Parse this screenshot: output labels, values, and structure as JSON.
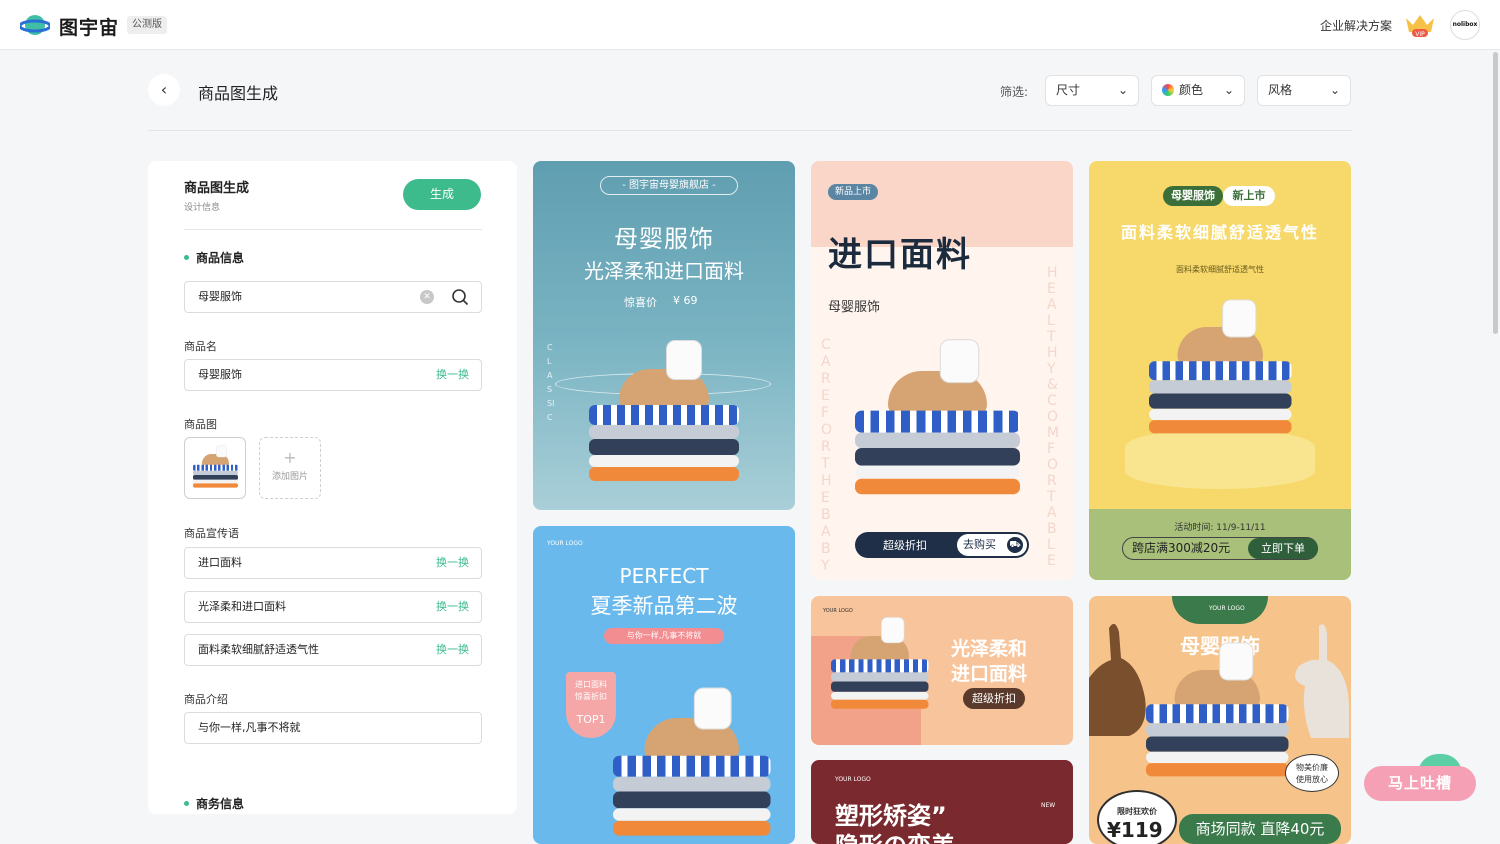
{
  "topbar": {
    "logo_text": "图宇宙",
    "beta_tag": "公测版",
    "enterprise": "企业解决方案",
    "vip_label": "VIP",
    "avatar_text": "nolibox"
  },
  "header": {
    "back_icon": "chevron-left-icon",
    "title": "商品图生成",
    "filter_label": "筛选:",
    "filters": [
      {
        "label": "尺寸"
      },
      {
        "label": "颜色"
      },
      {
        "label": "风格"
      }
    ]
  },
  "panel": {
    "title": "商品图生成",
    "subtitle": "设计信息",
    "generate_label": "生成",
    "section_product": "商品信息",
    "search_value": "母婴服饰",
    "name_label": "商品名",
    "name_value": "母婴服饰",
    "swap_label": "换一换",
    "image_label": "商品图",
    "add_image_label": "添加图片",
    "slogan_label": "商品宣传语",
    "slogans": [
      "进口面料",
      "光泽柔和进口面料",
      "面料柔软细腻舒适透气性"
    ],
    "intro_label": "商品介绍",
    "intro_value": "与你一样,凡事不将就",
    "section_business": "商务信息"
  },
  "cards": {
    "c1": {
      "store": "- 图宇宙母婴旗舰店 -",
      "line1": "母婴服饰",
      "line2": "光泽柔和进口面料",
      "price_label": "惊喜价",
      "price": "¥ 69",
      "side": "CLASSIC"
    },
    "c2": {
      "tag": "新品上市",
      "title": "进口面料",
      "sub": "母婴服饰",
      "side1": "CARE FOR THE BABY",
      "side2": "HEALTHY & COMFORTABLE",
      "btn1": "超级折扣",
      "btn2": "去购买"
    },
    "c3": {
      "tag1": "母婴服饰",
      "tag2": "新上市",
      "title": "面料柔软细腻舒适透气性",
      "sub": "面料柔软细腻舒适透气性",
      "time": "活动时间: 11/9-11/11",
      "promo": "跨店满300减20元",
      "cta": "立即下单"
    },
    "c4": {
      "logo": "YOUR LOGO",
      "title1": "PERFECT",
      "title2": "夏季新品第二波",
      "sub": "与你一样,凡事不将就",
      "badge1": "进口面料",
      "badge2": "惊喜折扣",
      "badge3": "TOP1"
    },
    "c5": {
      "logo": "YOUR LOGO",
      "title1": "光泽柔和",
      "title2": "进口面料",
      "btn": "超级折扣"
    },
    "c6": {
      "logo": "YOUR LOGO",
      "title": "塑形矫姿”",
      "title2": "隐形の变美",
      "tag": "NEW"
    },
    "c7": {
      "logo": "YOUR LOGO",
      "title": "母婴服饰",
      "bubble1": "物美价廉",
      "bubble2": "使用放心",
      "price_tag": "限时狂欢价",
      "price": "¥119",
      "promo": "商场同款 直降40元"
    }
  },
  "feedback_label": "马上吐槽"
}
